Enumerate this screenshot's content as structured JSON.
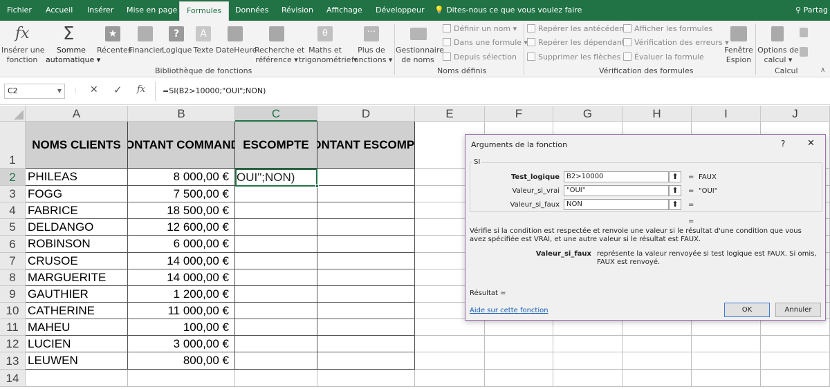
{
  "tabs": [
    "Fichier",
    "Accueil",
    "Insérer",
    "Mise en page",
    "Formules",
    "Données",
    "Révision",
    "Affichage",
    "Développeur"
  ],
  "tell_me": "Dites-nous ce que vous voulez faire",
  "share": "Partag",
  "ribbon": {
    "insert_function": [
      "Insérer une",
      "fonction"
    ],
    "autosum": [
      "Somme",
      "automatique"
    ],
    "recent": "Récentes",
    "financial": "Financier",
    "logical": "Logique",
    "text": "Texte",
    "datetime": "DateHeure",
    "lookup": [
      "Recherche et",
      "référence"
    ],
    "math": [
      "Maths et",
      "trigonométrie"
    ],
    "more": [
      "Plus de",
      "fonctions"
    ],
    "group_library": "Bibliothèque de fonctions",
    "name_manager": [
      "Gestionnaire",
      "de noms"
    ],
    "define_name": "Définir un nom",
    "use_in_formula": "Dans une formule",
    "from_selection": "Depuis sélection",
    "group_names": "Noms définis",
    "trace_precedents": "Repérer les antécédents",
    "trace_dependents": "Repérer les dépendants",
    "remove_arrows": "Supprimer les flèches",
    "show_formulas": "Afficher les formules",
    "error_checking": "Vérification des erreurs",
    "evaluate_formula": "Évaluer la formule",
    "watch_window": [
      "Fenêtre",
      "Espion"
    ],
    "group_audit": "Vérification des formules",
    "calc_options": [
      "Options de",
      "calcul"
    ],
    "group_calc": "Calcul"
  },
  "formula_bar": {
    "name_box": "C2",
    "formula": "=SI(B2>10000;\"OUI\";NON)",
    "fx": "fx"
  },
  "columns": [
    "A",
    "B",
    "C",
    "D",
    "E",
    "F",
    "G",
    "H",
    "I",
    "J"
  ],
  "rows": [
    "1",
    "2",
    "3",
    "4",
    "5",
    "6",
    "7",
    "8",
    "9",
    "10",
    "11",
    "12",
    "13",
    "14"
  ],
  "headers": [
    "NOMS CLIENTS",
    "MONTANT COMMANDE",
    "ESCOMPTE",
    "MONTANT ESCOMPTE"
  ],
  "data": [
    {
      "name": "PHILEAS",
      "amount": "8 000,00 €"
    },
    {
      "name": "FOGG",
      "amount": "7 500,00 €"
    },
    {
      "name": "FABRICE",
      "amount": "18 500,00 €"
    },
    {
      "name": "DELDANGO",
      "amount": "12 600,00 €"
    },
    {
      "name": "ROBINSON",
      "amount": "6 000,00 €"
    },
    {
      "name": "CRUSOE",
      "amount": "14 000,00 €"
    },
    {
      "name": "MARGUERITE",
      "amount": "14 000,00 €"
    },
    {
      "name": "GAUTHIER",
      "amount": "1 200,00 €"
    },
    {
      "name": "CATHERINE",
      "amount": "11 000,00 €"
    },
    {
      "name": "MAHEU",
      "amount": "100,00 €"
    },
    {
      "name": "LUCIEN",
      "amount": "3 000,00 €"
    },
    {
      "name": "LEUWEN",
      "amount": "800,00 €"
    }
  ],
  "editing_cell": "OUI\";NON)",
  "dialog": {
    "title": "Arguments de la fonction",
    "help": "?",
    "close": "✕",
    "fn": "SI",
    "args": [
      {
        "label": "Test_logique",
        "value": "B2>10000",
        "result": "FAUX"
      },
      {
        "label": "Valeur_si_vrai",
        "value": "\"OUI\"",
        "result": "\"OUI\""
      },
      {
        "label": "Valeur_si_faux",
        "value": "NON",
        "result": ""
      }
    ],
    "eq": "=",
    "description": "Vérifie si la condition est respectée et renvoie une valeur si le résultat d'une condition que vous avez spécifiée est VRAI, et une autre valeur si le résultat est FAUX.",
    "arg_name": "Valeur_si_faux",
    "arg_desc": "représente la valeur renvoyée si test logique est FAUX. Si omis, FAUX est renvoyé.",
    "result_label": "Résultat =",
    "help_link": "Aide sur cette fonction",
    "ok": "OK",
    "cancel": "Annuler"
  }
}
